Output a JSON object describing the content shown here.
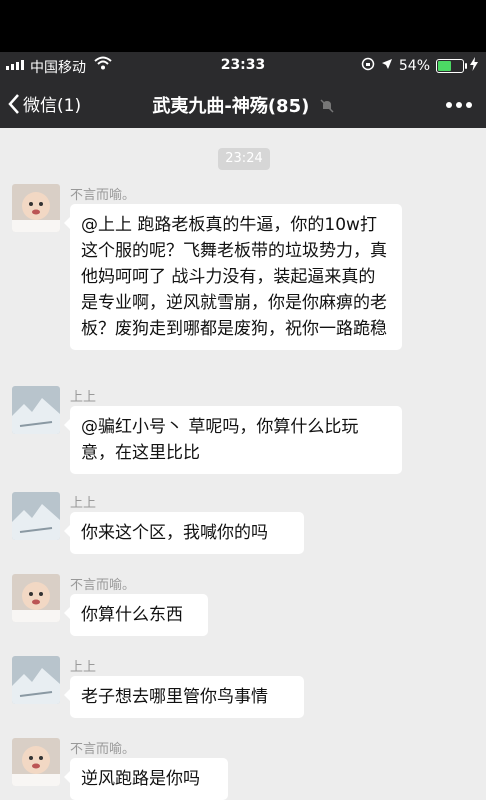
{
  "status": {
    "carrier": "中国移动",
    "time": "23:33",
    "battery": "54%",
    "battery_level": 0.54
  },
  "nav": {
    "back_label": "微信(1)",
    "title": "武夷九曲-神殇(85)"
  },
  "chat": {
    "timestamp": "23:24",
    "messages": [
      {
        "sender": "不言而喻。",
        "avatar": "baby-avatar",
        "text": "@上上 跑路老板真的牛逼，你的10w打这个服的呢？飞舞老板带的垃圾势力，真他妈呵呵了 战斗力没有，装起逼来真的是专业啊，逆风就雪崩，你是你麻痹的老板？废狗走到哪都是废狗，祝你一路跪稳"
      },
      {
        "sender": "上上",
        "avatar": "ice-avatar",
        "text": "@骗红小号丶 草呢吗，你算什么比玩意，在这里比比"
      },
      {
        "sender": "上上",
        "avatar": "ice-avatar",
        "text": "你来这个区，我喊你的吗"
      },
      {
        "sender": "不言而喻。",
        "avatar": "baby-avatar",
        "text": "你算什么东西"
      },
      {
        "sender": "上上",
        "avatar": "ice-avatar",
        "text": "老子想去哪里管你鸟事情"
      },
      {
        "sender": "不言而喻。",
        "avatar": "baby-avatar",
        "text": "逆风跑路是你吗"
      }
    ]
  },
  "colors": {
    "nav_bg": "#2b2b2d",
    "chat_bg": "#ededed",
    "bubble": "#ffffff",
    "battery": "#4cd964"
  }
}
